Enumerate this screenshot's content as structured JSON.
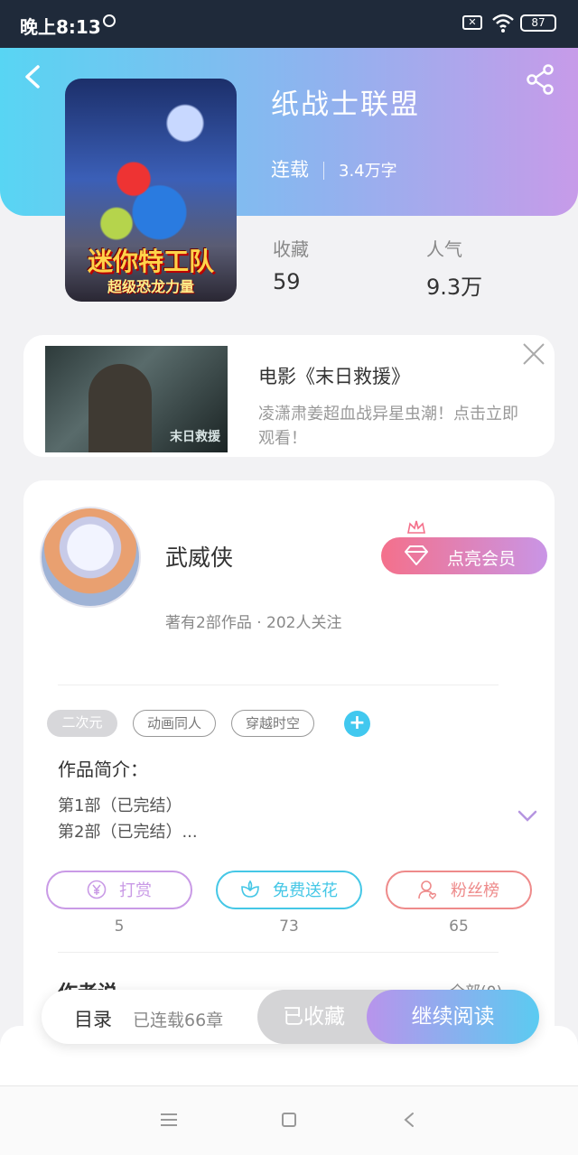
{
  "status_bar": {
    "time": "晚上8:13",
    "battery": "87"
  },
  "book": {
    "title": "纸战士联盟",
    "state": "连载",
    "word_count": "3.4万字",
    "cover_title": "迷你特工队",
    "cover_subtitle": "超级恐龙力量",
    "stats": [
      {
        "label": "收藏",
        "value": "59"
      },
      {
        "label": "人气",
        "value": "9.3万"
      }
    ]
  },
  "ad": {
    "title": "电影《末日救援》",
    "desc": "凌潇肃姜超血战异星虫潮！点击立即观看！",
    "image_text": "末日救援"
  },
  "author": {
    "name": "武威侠",
    "vip_label": "点亮会员",
    "info": "著有2部作品 · 202人关注"
  },
  "tags": [
    "二次元",
    "动画同人",
    "穿越时空"
  ],
  "add_tag": "+",
  "intro": {
    "heading": "作品简介：",
    "lines": [
      "第1部（已完结）",
      "第2部（已完结）..."
    ]
  },
  "actions": [
    {
      "label": "打赏",
      "count": "5",
      "color": "#c99ae6",
      "icon": "yen-icon"
    },
    {
      "label": "免费送花",
      "count": "73",
      "color": "#45c7e6",
      "icon": "flower-icon"
    },
    {
      "label": "粉丝榜",
      "count": "65",
      "color": "#ee8a8a",
      "icon": "fans-icon"
    }
  ],
  "author_says": {
    "heading": "作者说",
    "more": "全部(0)"
  },
  "bottom_bar": {
    "toc": "目录",
    "serial": "已连载66章",
    "favorited": "已收藏",
    "continue": "继续阅读"
  }
}
